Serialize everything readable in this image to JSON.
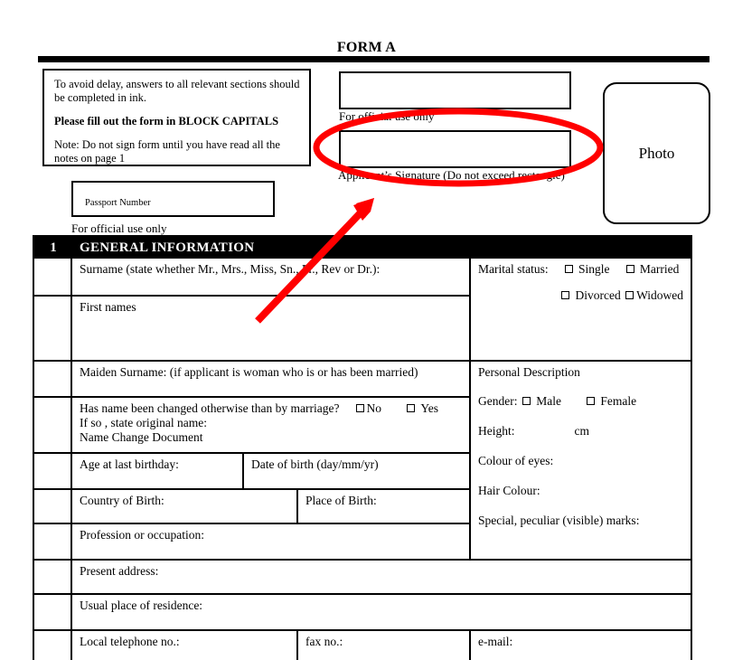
{
  "document": {
    "title": "FORM A"
  },
  "notes": {
    "lines": [
      "To avoid delay, answers to all relevant sections should be completed in ink.",
      "Please fill out the form in BLOCK CAPITALS",
      "Note: Do not sign form until you have read all the notes on page 1"
    ]
  },
  "passport": {
    "field_label": "Passport Number",
    "caption": "For official use only"
  },
  "official": {
    "caption": "For official use only"
  },
  "signature": {
    "caption": "Applicant’s Signature (Do not exceed rectangle)"
  },
  "photo": {
    "label": "Photo"
  },
  "section": {
    "number": "1",
    "title": "GENERAL INFORMATION"
  },
  "fields": {
    "surname": "Surname (state whether Mr., Mrs., Miss, Sn., Fr., Rev or Dr.):",
    "first_names": "First names",
    "maiden_surname": "Maiden Surname: (if applicant is woman who is or has been married)",
    "name_changed_question": "Has name been changed otherwise than by marriage?",
    "name_changed_no": "No",
    "name_changed_yes": "Yes",
    "original_name": "If so , state original name:",
    "name_change_document": "Name Change Document",
    "age_at_last_birthday": "Age at last birthday:",
    "date_of_birth": "Date of birth (day/mm/yr)",
    "country_of_birth": "Country of Birth:",
    "place_of_birth": "Place of Birth:",
    "profession": "Profession or occupation:",
    "present_address": "Present address:",
    "usual_residence": "Usual place of residence:",
    "local_telephone": "Local telephone no.:",
    "fax": "fax no.:",
    "email": "e-mail:"
  },
  "marital": {
    "label": "Marital status:",
    "options": [
      "Single",
      "Married",
      "Divorced",
      "Widowed"
    ]
  },
  "personal_description": {
    "heading": "Personal Description",
    "gender_label": "Gender:",
    "gender_options": [
      "Male",
      "Female"
    ],
    "height_label": "Height:",
    "height_unit": "cm",
    "eye_colour": "Colour of eyes:",
    "hair_colour": "Hair Colour:",
    "special_marks": "Special, peculiar (visible) marks:"
  },
  "annotations": {
    "highlight_colour": "#FF0000",
    "ellipse_name": "signature-highlight-ellipse",
    "arrow_name": "signature-pointer-arrow"
  }
}
